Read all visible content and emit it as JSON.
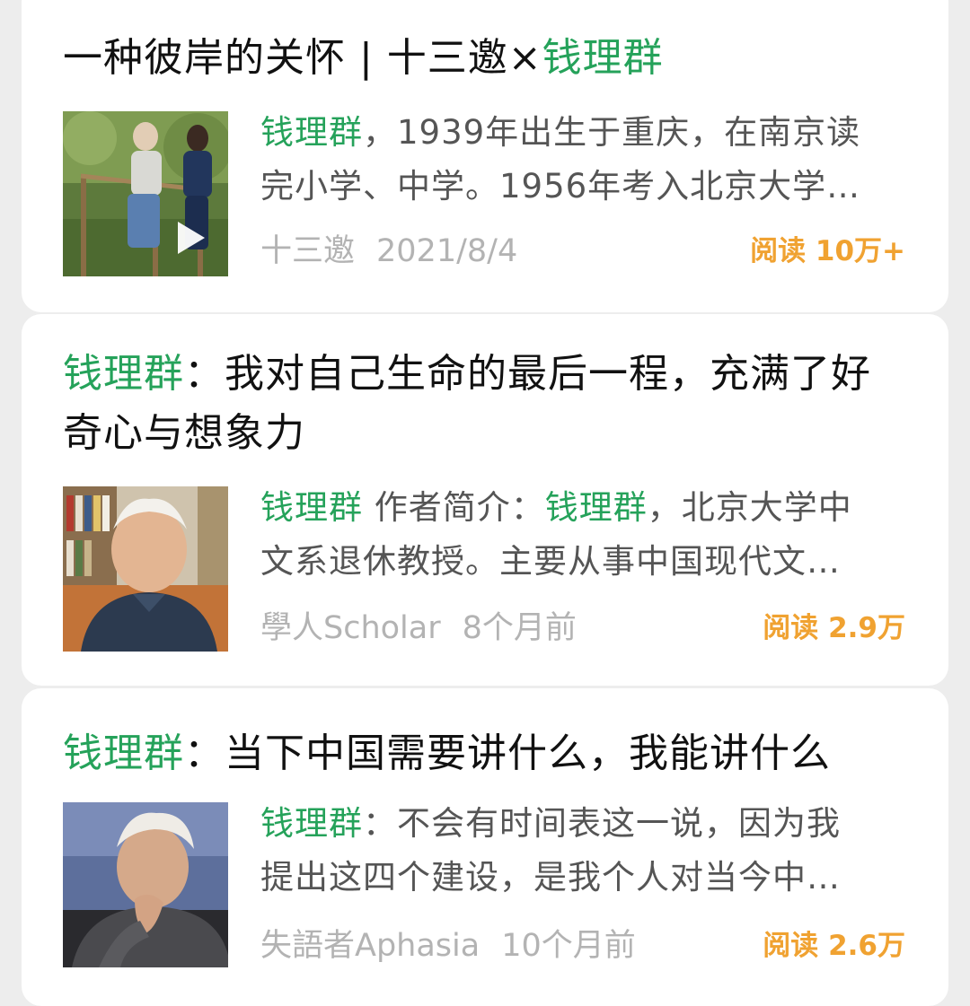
{
  "results": [
    {
      "title_prefix": "一种彼岸的关怀 | 十三邀×",
      "title_highlight": "钱理群",
      "title_suffix": "",
      "summary_line1_highlight": "钱理群",
      "summary_line1_rest": "，1939年出生于重庆，在南京读",
      "summary_line2": "完小学、中学。1956年考入北京大学…",
      "source": "十三邀",
      "date": "2021/8/4",
      "reads": "阅读 10万+",
      "thumb_icon": "video-play-icon"
    },
    {
      "title_highlight": "钱理群",
      "title_rest_line1": "：我对自己生命的最后一程，充满了好",
      "title_line2": "奇心与想象力",
      "summary_a_highlight": "钱理群",
      "summary_b": " 作者简介：",
      "summary_c_highlight": "钱理群",
      "summary_d": "，北京大学中",
      "summary_line2": "文系退休教授。主要从事中国现代文…",
      "source": "學人Scholar",
      "date": "8个月前",
      "reads": "阅读 2.9万"
    },
    {
      "title_highlight": "钱理群",
      "title_rest": "：当下中国需要讲什么，我能讲什么",
      "summary_line1_highlight": "钱理群",
      "summary_line1_rest": "：不会有时间表这一说，因为我",
      "summary_line2": "提出这四个建设，是我个人对当今中…",
      "source": "失語者Aphasia",
      "date": "10个月前",
      "reads": "阅读 2.6万"
    }
  ],
  "colors": {
    "highlight": "#25a25a",
    "reads": "#f0a231",
    "meta": "#b3b3b3",
    "background": "#ededed"
  }
}
